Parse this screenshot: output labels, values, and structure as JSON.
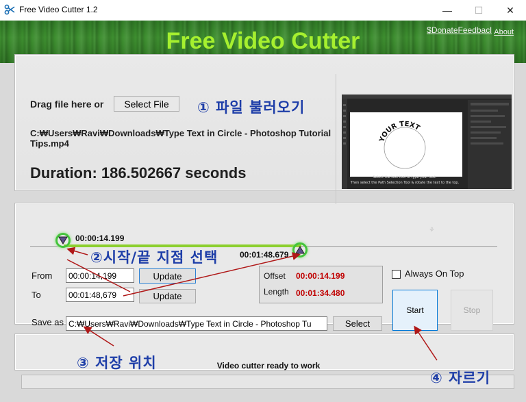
{
  "window": {
    "title": "Free Video Cutter 1.2",
    "minimize_glyph": "—",
    "maximize_glyph": "☐",
    "close_glyph": "✕"
  },
  "header": {
    "title": "Free Video Cutter",
    "links": {
      "donate": "$Donate",
      "feedback": "Feedbacl",
      "about": "About"
    }
  },
  "file_panel": {
    "drag_label": "Drag file here or",
    "select_file_label": "Select File",
    "file_path": "C:₩Users₩Ravi₩Downloads₩Type Text in Circle - Photoshop Tutorial Tips.mp4",
    "duration_text": "Duration: 186.502667 seconds",
    "thumbnail": {
      "circle_text": "YOUR TEXT",
      "caption_line1": "Select the  text tool  to type your text.",
      "caption_line2": "Then select the Path Selection Tool & rotate the text to the top."
    }
  },
  "timeline": {
    "start_time": "00:00:14.199",
    "end_time": "00:01:48.679",
    "start_marker_glyph": "▼",
    "end_marker_glyph": "▲",
    "selection_start_fraction": 0.076,
    "selection_end_fraction": 0.583
  },
  "cut_panel": {
    "from_label": "From",
    "to_label": "To",
    "from_value": "00:00:14,199",
    "to_value": "00:01:48,679",
    "update_label": "Update",
    "offset_label": "Offset",
    "offset_value": "00:00:14.199",
    "length_label": "Length",
    "length_value": "00:01:34.480",
    "always_on_top_label": "Always On Top",
    "always_on_top_checked": false,
    "save_as_label": "Save as",
    "save_path": "C:₩Users₩Ravi₩Downloads₩Type Text in Circle - Photoshop Tu",
    "select_label": "Select",
    "start_label": "Start",
    "stop_label": "Stop"
  },
  "status": {
    "text": "Video cutter ready to work",
    "progress": 0
  },
  "annotations": {
    "step1": "① 파일 불러오기",
    "step2": "②시작/끝 지점 선택",
    "step3": "③ 저장 위치",
    "step4": "④ 자르기"
  },
  "colors": {
    "header_title": "#a6f02f",
    "header_bg": "#3e8f30",
    "annotation": "#1e3ea8",
    "arrow": "#b01818",
    "value_red": "#c00000",
    "marker_glow": "#44c43c"
  }
}
